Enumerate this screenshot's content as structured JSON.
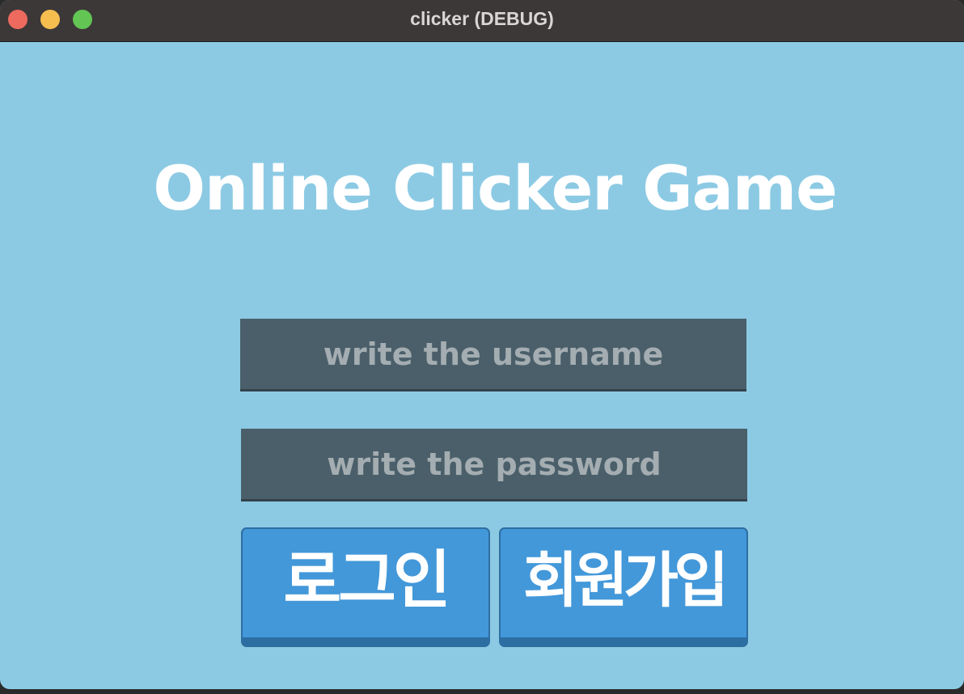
{
  "window": {
    "title": "clicker (DEBUG)"
  },
  "game": {
    "title": "Online Clicker Game",
    "username_placeholder": "write the username",
    "password_placeholder": "write the password",
    "login_label": "로그인",
    "signup_label": "회원가입"
  },
  "colors": {
    "background": "#8ccae4",
    "titlebar": "#3d3838",
    "field": "#4a5f6a",
    "button": "#4398d9"
  }
}
